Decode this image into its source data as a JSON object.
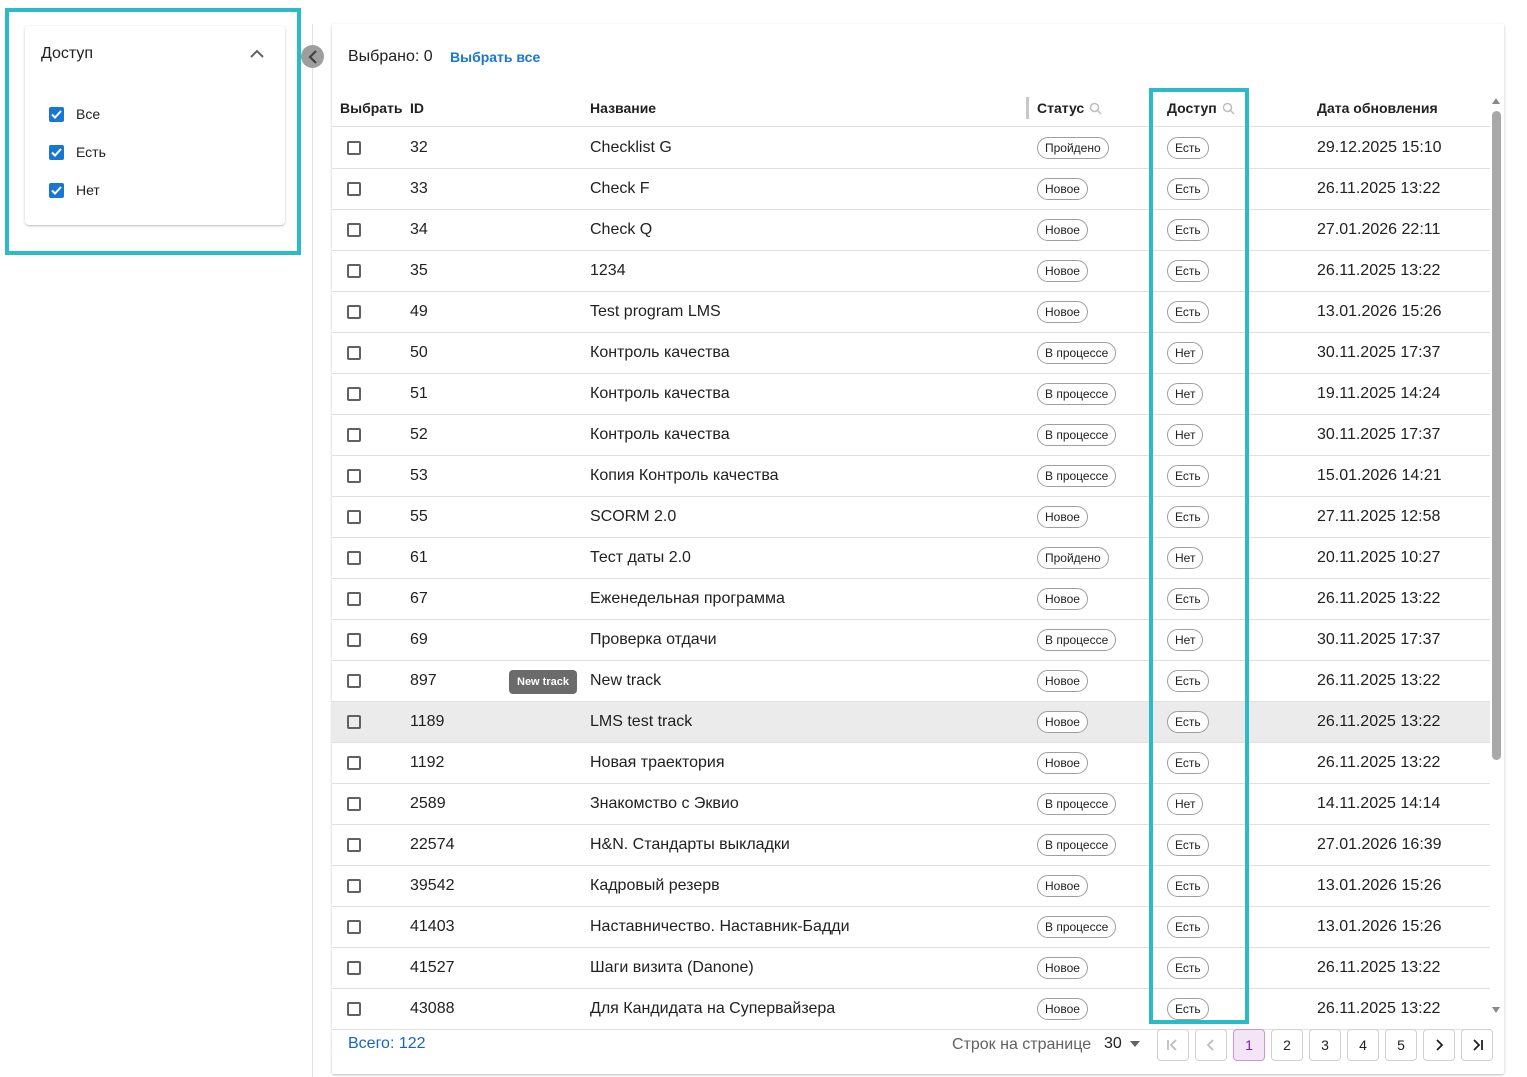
{
  "filter": {
    "title": "Доступ",
    "options": [
      {
        "label": "Все",
        "checked": true
      },
      {
        "label": "Есть",
        "checked": true
      },
      {
        "label": "Нет",
        "checked": true
      }
    ]
  },
  "toolbar": {
    "selected_label": "Выбрано: 0",
    "select_all_label": "Выбрать все"
  },
  "table": {
    "headers": {
      "select": "Выбрать",
      "id": "ID",
      "name": "Название",
      "status": "Статус",
      "access": "Доступ",
      "updated": "Дата обновления"
    },
    "rows": [
      {
        "id": "32",
        "tag": "",
        "name": "Checklist G",
        "status": "Пройдено",
        "access": "Есть",
        "updated": "29.12.2025 15:10"
      },
      {
        "id": "33",
        "tag": "",
        "name": "Check F",
        "status": "Новое",
        "access": "Есть",
        "updated": "26.11.2025 13:22"
      },
      {
        "id": "34",
        "tag": "",
        "name": "Check Q",
        "status": "Новое",
        "access": "Есть",
        "updated": "27.01.2026 22:11"
      },
      {
        "id": "35",
        "tag": "",
        "name": "1234",
        "status": "Новое",
        "access": "Есть",
        "updated": "26.11.2025 13:22"
      },
      {
        "id": "49",
        "tag": "",
        "name": "Test program LMS",
        "status": "Новое",
        "access": "Есть",
        "updated": "13.01.2026 15:26"
      },
      {
        "id": "50",
        "tag": "",
        "name": "Контроль качества",
        "status": "В процессе",
        "access": "Нет",
        "updated": "30.11.2025 17:37"
      },
      {
        "id": "51",
        "tag": "",
        "name": "Контроль качества",
        "status": "В процессе",
        "access": "Нет",
        "updated": "19.11.2025 14:24"
      },
      {
        "id": "52",
        "tag": "",
        "name": "Контроль качества",
        "status": "В процессе",
        "access": "Нет",
        "updated": "30.11.2025 17:37"
      },
      {
        "id": "53",
        "tag": "",
        "name": "Копия Контроль качества",
        "status": "В процессе",
        "access": "Есть",
        "updated": "15.01.2026 14:21"
      },
      {
        "id": "55",
        "tag": "",
        "name": "SCORM 2.0",
        "status": "Новое",
        "access": "Есть",
        "updated": "27.11.2025 12:58"
      },
      {
        "id": "61",
        "tag": "",
        "name": "Тест даты 2.0",
        "status": "Пройдено",
        "access": "Нет",
        "updated": "20.11.2025 10:27"
      },
      {
        "id": "67",
        "tag": "",
        "name": "Еженедельная программа",
        "status": "Новое",
        "access": "Есть",
        "updated": "26.11.2025 13:22"
      },
      {
        "id": "69",
        "tag": "",
        "name": "Проверка отдачи",
        "status": "В процессе",
        "access": "Нет",
        "updated": "30.11.2025 17:37"
      },
      {
        "id": "897",
        "tag": "New track",
        "name": "New track",
        "status": "Новое",
        "access": "Есть",
        "updated": "26.11.2025 13:22"
      },
      {
        "id": "1189",
        "tag": "",
        "name": "LMS test track",
        "status": "Новое",
        "access": "Есть",
        "updated": "26.11.2025 13:22"
      },
      {
        "id": "1192",
        "tag": "",
        "name": "Новая траектория",
        "status": "Новое",
        "access": "Есть",
        "updated": "26.11.2025 13:22"
      },
      {
        "id": "2589",
        "tag": "",
        "name": "Знакомство с Эквио",
        "status": "В процессе",
        "access": "Нет",
        "updated": "14.11.2025 14:14"
      },
      {
        "id": "22574",
        "tag": "",
        "name": "H&N. Стандарты выкладки",
        "status": "В процессе",
        "access": "Есть",
        "updated": "27.01.2026 16:39"
      },
      {
        "id": "39542",
        "tag": "",
        "name": "Кадровый резерв",
        "status": "Новое",
        "access": "Есть",
        "updated": "13.01.2026 15:26"
      },
      {
        "id": "41403",
        "tag": "",
        "name": "Наставничество. Наставник-Бадди",
        "status": "В процессе",
        "access": "Есть",
        "updated": "13.01.2026 15:26"
      },
      {
        "id": "41527",
        "tag": "",
        "name": "Шаги визита (Danone)",
        "status": "Новое",
        "access": "Есть",
        "updated": "26.11.2025 13:22"
      },
      {
        "id": "43088",
        "tag": "",
        "name": "Для Кандидата на Супервайзера",
        "status": "Новое",
        "access": "Есть",
        "updated": "26.11.2025 13:22"
      }
    ]
  },
  "footer": {
    "total_label": "Всего: 122",
    "rows_per_page_label": "Строк на странице",
    "rows_per_page_value": "30",
    "pages": [
      "1",
      "2",
      "3",
      "4",
      "5"
    ],
    "current_page": "1"
  },
  "colors": {
    "highlight": "#2bbac8",
    "accent": "#1976d2",
    "active_page_bg": "#f3e5f5"
  }
}
